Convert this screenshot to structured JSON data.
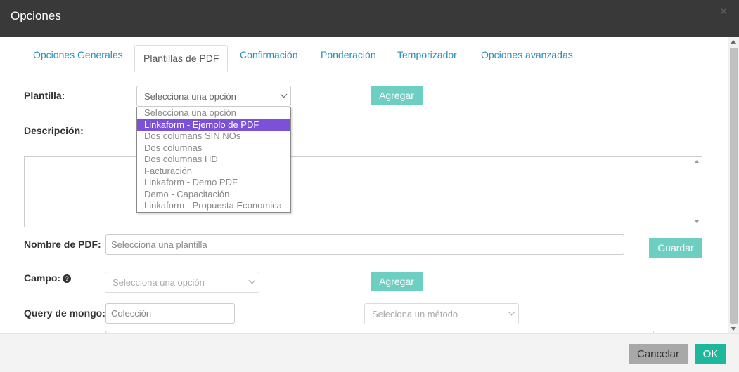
{
  "dialog": {
    "title": "Opciones"
  },
  "tabs": [
    {
      "label": "Opciones Generales"
    },
    {
      "label": "Plantillas de PDF"
    },
    {
      "label": "Confirmación"
    },
    {
      "label": "Ponderación"
    },
    {
      "label": "Temporizador"
    },
    {
      "label": "Opciones avanzadas"
    }
  ],
  "active_tab": "Plantillas de PDF",
  "form": {
    "plantilla_label": "Plantilla:",
    "plantilla_value": "Selecciona una opción",
    "agregar_label": "Agregar",
    "descripcion_label": "Descripción:",
    "nombre_pdf_label": "Nombre de PDF:",
    "nombre_pdf_placeholder": "Selecciona una plantilla",
    "guardar_label": "Guardar",
    "campo_label": "Campo:",
    "campo_value": "Selecciona una opción",
    "agregar2_label": "Agregar",
    "query_label": "Query de mongo:",
    "coleccion_placeholder": "Colección",
    "metodo_value": "Seleciona un método"
  },
  "dropdown": {
    "options": [
      "Selecciona una opción",
      "Linkaform - Ejemplo de PDF",
      "Dos columans SIN NOs",
      "Dos columnas",
      "Dos columnas HD",
      "Facturación",
      "Linkaform - Demo PDF",
      "Demo - Capacitación",
      "Linkaform - Propuesta Economica"
    ],
    "highlighted": "Linkaform - Ejemplo de PDF"
  },
  "footer": {
    "cancel_label": "Cancelar",
    "ok_label": "OK"
  },
  "colors": {
    "titlebar": "#393939",
    "accent_teal": "#6dcfc1",
    "ok": "#1db89b",
    "highlight": "#7b52d6",
    "link": "#2a8fb8"
  }
}
